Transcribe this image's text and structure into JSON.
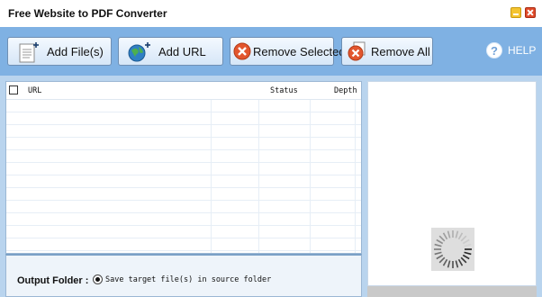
{
  "window": {
    "title": "Free Website to PDF Converter"
  },
  "toolbar": {
    "add_files": "Add File(s)",
    "add_url": "Add URL",
    "remove_selected": "Remove Selected",
    "remove_all": "Remove All",
    "help": "HELP",
    "icons": {
      "add_files": "add-file-icon",
      "add_url": "add-url-icon",
      "remove_selected": "remove-icon",
      "remove_all": "remove-icon",
      "help": "help-icon"
    }
  },
  "grid": {
    "columns": [
      "URL",
      "Status",
      "Depth"
    ],
    "rows": []
  },
  "output": {
    "label": "Output Folder :",
    "option": "Save target file(s) in source folder",
    "option_selected": true
  },
  "colors": {
    "toolbar_bg": "#7fb1e3",
    "main_bg": "#b9d4ee",
    "remove_red": "#e2562e"
  }
}
